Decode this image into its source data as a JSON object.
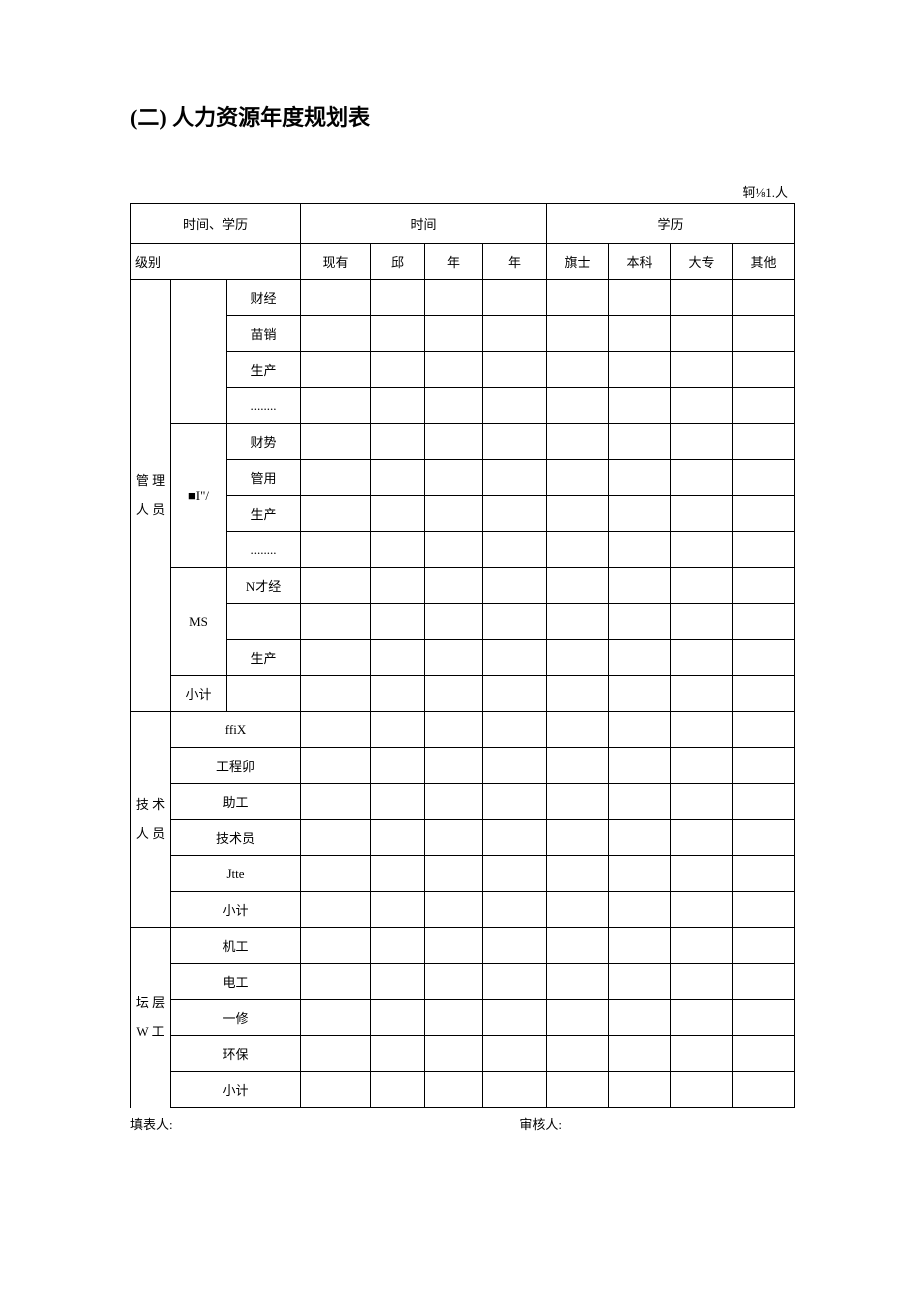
{
  "title": "(二) 人力资源年度规划表",
  "unit_label": "轲⅛1.人",
  "header": {
    "corner": "时间、学历",
    "time_group": "时间",
    "edu_group": "学历",
    "level_label": "级别",
    "cols": {
      "c1": "现有",
      "c2": "邱",
      "c3": "年",
      "c4": "年",
      "c5": "旗士",
      "c6": "本科",
      "c7": "大专",
      "c8": "其他"
    }
  },
  "groups": {
    "g1": {
      "label": "管 理 人 员",
      "sub1": {
        "label": "",
        "rows": [
          "财经",
          "苗销",
          "生产",
          "........"
        ]
      },
      "sub2": {
        "label": "■I\"/",
        "rows": [
          "财势",
          "管用",
          "生产",
          "........"
        ]
      },
      "sub3": {
        "label": "MS",
        "rows": [
          "N才经",
          "",
          "生产"
        ]
      },
      "subtotal": "小计"
    },
    "g2": {
      "label": "技 术 人 员",
      "rows": [
        "ffiX",
        "工程卯",
        "助工",
        "技术员",
        "Jtte",
        "小计"
      ]
    },
    "g3": {
      "label": "坛 层 W 工",
      "rows": [
        "机工",
        "电工",
        "一修",
        "环保",
        "小计"
      ]
    }
  },
  "footer": {
    "left": "填表人:",
    "right": "审核人:"
  }
}
